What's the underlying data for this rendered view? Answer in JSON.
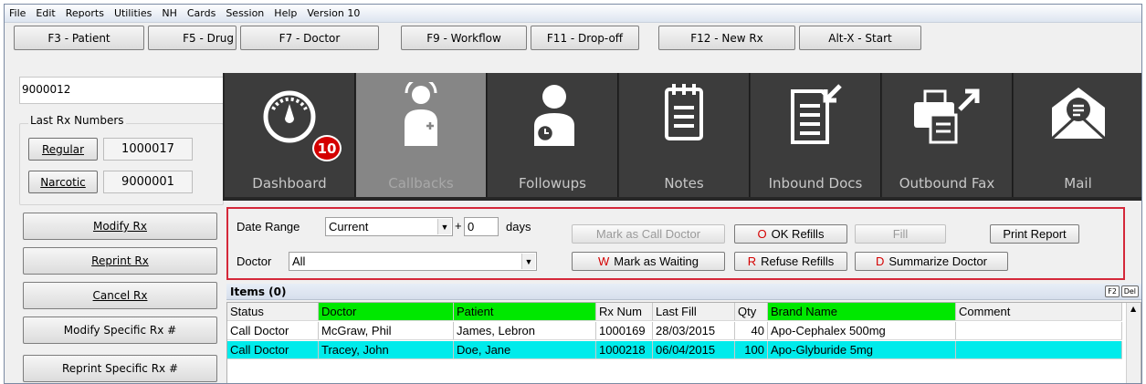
{
  "menu": [
    "File",
    "Edit",
    "Reports",
    "Utilities",
    "NH",
    "Cards",
    "Session",
    "Help",
    "Version 10"
  ],
  "fkeys": [
    "F3 - Patient",
    "F5 - Drug",
    "F7 - Doctor",
    "F9 - Workflow",
    "F11 - Drop-off",
    "F12 - New Rx",
    "Alt-X - Start"
  ],
  "rx_input": "9000012",
  "last_rx": {
    "title": "Last Rx Numbers",
    "regular_label": "Regular",
    "regular_value": "1000017",
    "narcotic_label": "Narcotic",
    "narcotic_value": "9000001"
  },
  "left_buttons": [
    "Modify Rx",
    "Reprint Rx",
    "Cancel Rx",
    "Modify Specific Rx #",
    "Reprint Specific Rx #"
  ],
  "tiles": [
    {
      "label": "Dashboard",
      "icon": "gauge-icon",
      "badge": "10"
    },
    {
      "label": "Callbacks",
      "icon": "doctor-icon",
      "active": true
    },
    {
      "label": "Followups",
      "icon": "person-clock-icon"
    },
    {
      "label": "Notes",
      "icon": "notes-icon"
    },
    {
      "label": "Inbound Docs",
      "icon": "inbound-doc-icon"
    },
    {
      "label": "Outbound Fax",
      "icon": "fax-icon"
    },
    {
      "label": "Mail",
      "icon": "mail-icon"
    }
  ],
  "filter": {
    "date_range_label": "Date Range",
    "date_range_value": "Current",
    "plus": "+",
    "days_value": "0",
    "days_label": "days",
    "doctor_label": "Doctor",
    "doctor_value": "All",
    "mark_call_doctor": "Mark as Call Doctor",
    "ok_refills_key": "O",
    "ok_refills": "OK Refills",
    "fill": "Fill",
    "print_report": "Print Report",
    "mark_waiting_key": "W",
    "mark_waiting": "Mark as Waiting",
    "refuse_key": "R",
    "refuse_refills": "Refuse Refills",
    "summarize_key": "D",
    "summarize_doctor": "Summarize Doctor"
  },
  "grid": {
    "title": "Items (0)",
    "keys": [
      "F2",
      "Del"
    ],
    "columns": [
      "Status",
      "Doctor",
      "Patient",
      "Rx Num",
      "Last Fill",
      "Qty",
      "Brand Name",
      "Comment"
    ],
    "rows": [
      [
        "Call Doctor",
        "McGraw, Phil",
        "James, Lebron",
        "1000169",
        "28/03/2015",
        "40",
        "Apo-Cephalex 500mg",
        ""
      ],
      [
        "Call Doctor",
        "Tracey, John",
        "Doe, Jane",
        "1000218",
        "06/04/2015",
        "100",
        "Apo-Glyburide 5mg",
        ""
      ]
    ]
  },
  "colors": {
    "highlight": "#00ebeb",
    "header_green": "#00e800",
    "border_red": "#d4283a",
    "badge_red": "#d40000"
  }
}
